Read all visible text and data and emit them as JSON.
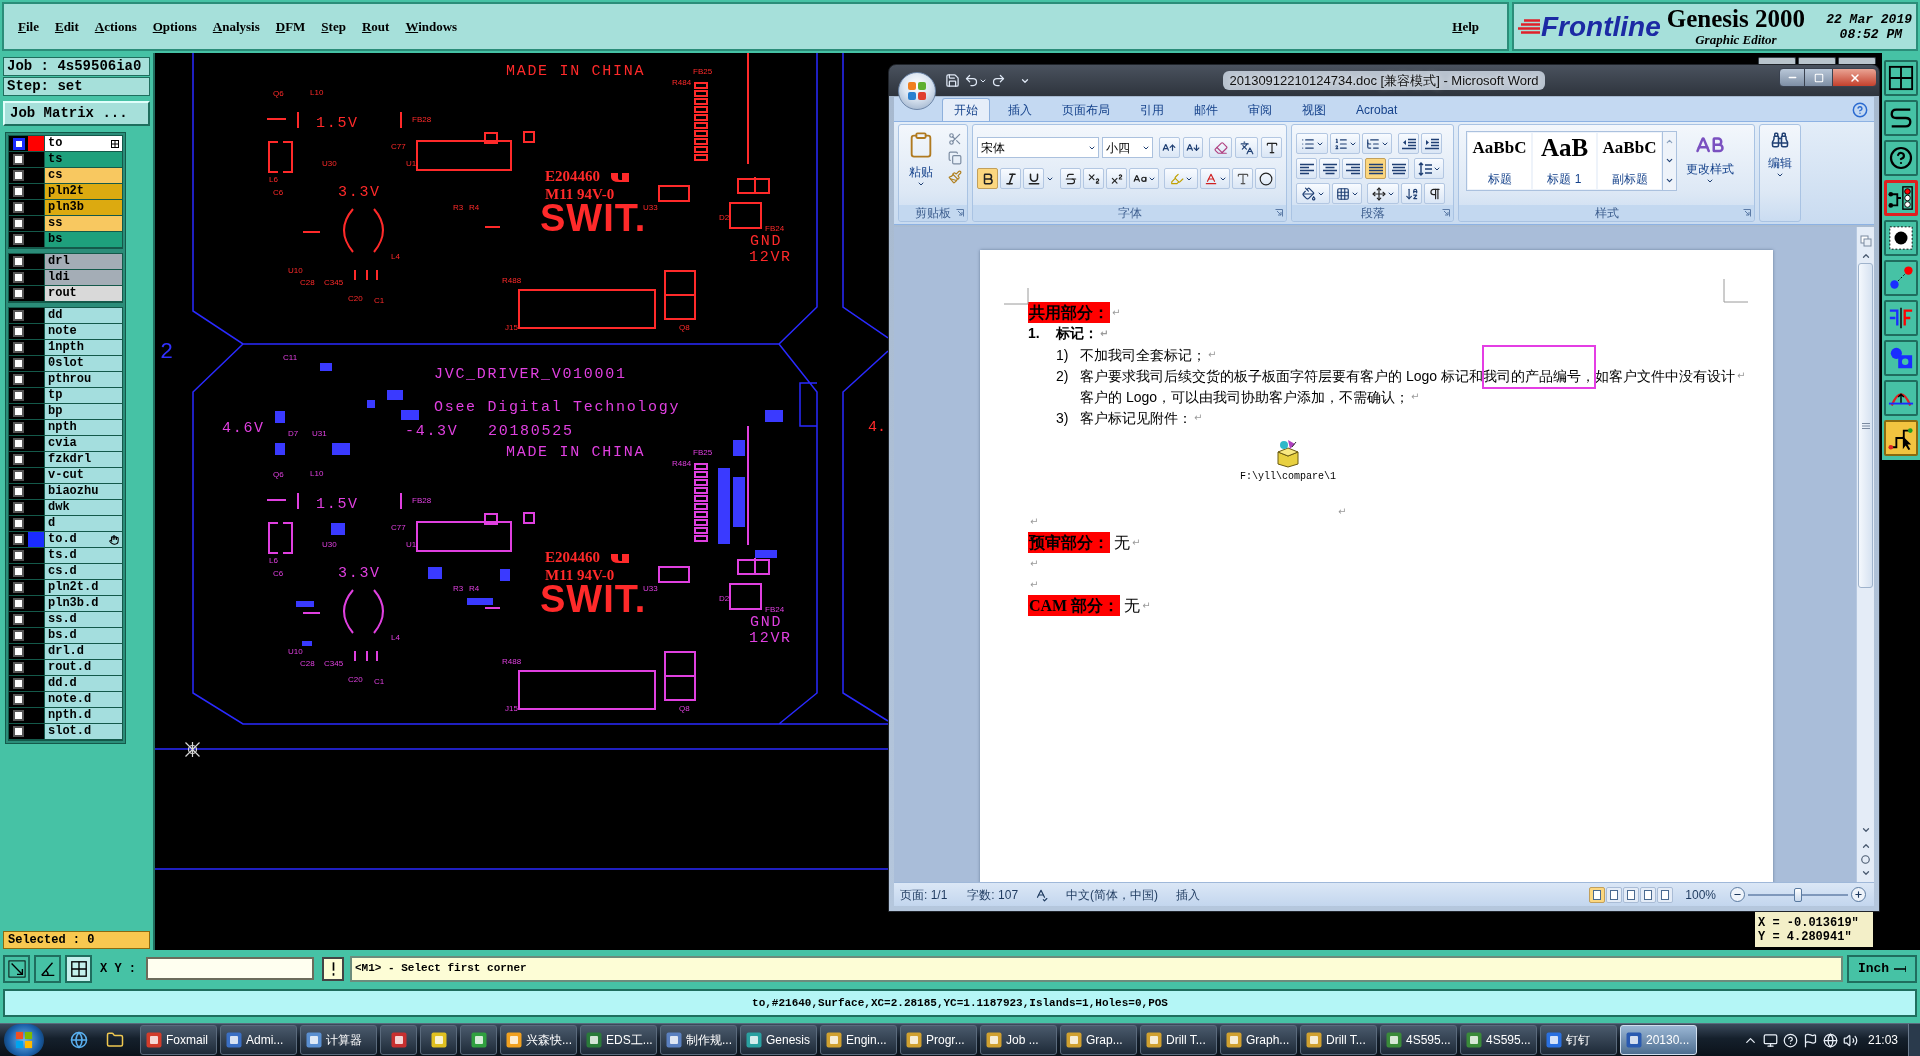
{
  "menu_bar": {
    "items": [
      "File",
      "Edit",
      "Actions",
      "Options",
      "Analysis",
      "DFM",
      "Step",
      "Rout",
      "Windows"
    ],
    "help": "Help"
  },
  "brand": {
    "logo": "Frontline",
    "product": "Genesis 2000",
    "subtitle": "Graphic Editor",
    "date": "22 Mar 2019",
    "time": "08:52 PM"
  },
  "job_panel": {
    "job": "Job : 4s59506ia0",
    "step": "Step: set",
    "matrix_button": "Job Matrix ...",
    "layer_groups": [
      {
        "layers": [
          {
            "name": "to",
            "color": "#ffffff",
            "display": {
              "color": "#ff0000"
            },
            "checked": true,
            "kind": "work"
          },
          {
            "name": "ts",
            "color": "#1ea07c",
            "display": {
              "color": "#000000"
            },
            "checked": false,
            "kind": "plain"
          },
          {
            "name": "cs",
            "color": "#f8c860",
            "display": {
              "color": "#000000"
            },
            "checked": false,
            "kind": "plain"
          },
          {
            "name": "pln2t",
            "color": "#dcaa10",
            "display": {
              "color": "#000000"
            },
            "checked": false,
            "kind": "plain"
          },
          {
            "name": "pln3b",
            "color": "#dcaa10",
            "display": {
              "color": "#000000"
            },
            "checked": false,
            "kind": "plain"
          },
          {
            "name": "ss",
            "color": "#f8c860",
            "display": {
              "color": "#000000"
            },
            "checked": false,
            "kind": "plain"
          },
          {
            "name": "bs",
            "color": "#1ea07c",
            "display": {
              "color": "#000000"
            },
            "checked": false,
            "kind": "plain"
          }
        ]
      },
      {
        "layers": [
          {
            "name": "drl",
            "color": "#a4adb6",
            "display": {
              "color": "#000000"
            },
            "checked": false,
            "kind": "plain"
          },
          {
            "name": "ldi",
            "color": "#a4adb6",
            "display": {
              "color": "#000000"
            },
            "checked": false,
            "kind": "plain"
          },
          {
            "name": "rout",
            "color": "#d9d9d9",
            "display": {
              "color": "#000000"
            },
            "checked": false,
            "kind": "plain"
          }
        ]
      },
      {
        "layers": [
          {
            "name": "dd",
            "color": "#a4dede",
            "display": {
              "color": "#000000"
            },
            "checked": false,
            "kind": "plain"
          },
          {
            "name": "note",
            "color": "#a4dede",
            "display": {
              "color": "#000000"
            },
            "checked": false,
            "kind": "plain"
          },
          {
            "name": "1npth",
            "color": "#a4dede",
            "display": {
              "color": "#000000"
            },
            "checked": false,
            "kind": "plain"
          },
          {
            "name": "0slot",
            "color": "#a4dede",
            "display": {
              "color": "#000000"
            },
            "checked": false,
            "kind": "plain"
          },
          {
            "name": "pthrou",
            "color": "#a4dede",
            "display": {
              "color": "#000000"
            },
            "checked": false,
            "kind": "plain"
          },
          {
            "name": "tp",
            "color": "#a4dede",
            "display": {
              "color": "#000000"
            },
            "checked": false,
            "kind": "plain"
          },
          {
            "name": "bp",
            "color": "#a4dede",
            "display": {
              "color": "#000000"
            },
            "checked": false,
            "kind": "plain"
          },
          {
            "name": "npth",
            "color": "#a4dede",
            "display": {
              "color": "#000000"
            },
            "checked": false,
            "kind": "plain"
          },
          {
            "name": "cvia",
            "color": "#a4dede",
            "display": {
              "color": "#000000"
            },
            "checked": false,
            "kind": "plain"
          },
          {
            "name": "fzkdrl",
            "color": "#a4dede",
            "display": {
              "color": "#000000"
            },
            "checked": false,
            "kind": "plain"
          },
          {
            "name": "v-cut",
            "color": "#a4dede",
            "display": {
              "color": "#000000"
            },
            "checked": false,
            "kind": "plain"
          },
          {
            "name": "biaozhu",
            "color": "#a4dede",
            "display": {
              "color": "#000000"
            },
            "checked": false,
            "kind": "plain"
          },
          {
            "name": "dwk",
            "color": "#a4dede",
            "display": {
              "color": "#000000"
            },
            "checked": false,
            "kind": "plain"
          },
          {
            "name": "d",
            "color": "#a4dede",
            "display": {
              "color": "#000000"
            },
            "checked": false,
            "kind": "plain"
          },
          {
            "name": "to.d",
            "color": "#a4dede",
            "display": {
              "color": "#1a2cff"
            },
            "checked": false,
            "kind": "edit"
          },
          {
            "name": "ts.d",
            "color": "#a4dede",
            "display": {
              "color": "#000000"
            },
            "checked": false,
            "kind": "plain"
          },
          {
            "name": "cs.d",
            "color": "#a4dede",
            "display": {
              "color": "#000000"
            },
            "checked": false,
            "kind": "plain"
          },
          {
            "name": "pln2t.d",
            "color": "#a4dede",
            "display": {
              "color": "#000000"
            },
            "checked": false,
            "kind": "plain"
          },
          {
            "name": "pln3b.d",
            "color": "#a4dede",
            "display": {
              "color": "#000000"
            },
            "checked": false,
            "kind": "plain"
          },
          {
            "name": "ss.d",
            "color": "#a4dede",
            "display": {
              "color": "#000000"
            },
            "checked": false,
            "kind": "plain"
          },
          {
            "name": "bs.d",
            "color": "#a4dede",
            "display": {
              "color": "#000000"
            },
            "checked": false,
            "kind": "plain"
          },
          {
            "name": "drl.d",
            "color": "#a4dede",
            "display": {
              "color": "#000000"
            },
            "checked": false,
            "kind": "plain"
          },
          {
            "name": "rout.d",
            "color": "#a4dede",
            "display": {
              "color": "#000000"
            },
            "checked": false,
            "kind": "plain"
          },
          {
            "name": "dd.d",
            "color": "#a4dede",
            "display": {
              "color": "#000000"
            },
            "checked": false,
            "kind": "plain"
          },
          {
            "name": "note.d",
            "color": "#a4dede",
            "display": {
              "color": "#000000"
            },
            "checked": false,
            "kind": "plain"
          },
          {
            "name": "npth.d",
            "color": "#a4dede",
            "display": {
              "color": "#000000"
            },
            "checked": false,
            "kind": "plain"
          },
          {
            "name": "slot.d",
            "color": "#a4dede",
            "display": {
              "color": "#000000"
            },
            "checked": false,
            "kind": "plain"
          }
        ]
      }
    ],
    "selected": "Selected : 0"
  },
  "canvas": {
    "boards": [
      {
        "color": "#ff2a2a",
        "labels": [
          {
            "text": "MADE IN CHINA",
            "kind": "text"
          },
          {
            "text": "FB25",
            "kind": "ref"
          },
          {
            "text": "R484",
            "kind": "ref"
          },
          {
            "text": "Q6",
            "kind": "ref"
          },
          {
            "text": "L10",
            "kind": "ref"
          },
          {
            "text": "1.5V",
            "kind": "text"
          },
          {
            "text": "FB28",
            "kind": "ref"
          },
          {
            "text": "C77",
            "kind": "ref"
          },
          {
            "text": "U30",
            "kind": "ref"
          },
          {
            "text": "U1",
            "kind": "ref"
          },
          {
            "text": "L6",
            "kind": "ref"
          },
          {
            "text": "E204460",
            "kind": "mark"
          },
          {
            "text": "C6",
            "kind": "ref"
          },
          {
            "text": "3.3V",
            "kind": "text"
          },
          {
            "text": "M11 94V-0",
            "kind": "mark"
          },
          {
            "text": "R3",
            "kind": "ref"
          },
          {
            "text": "R4",
            "kind": "ref"
          },
          {
            "text": "SWIT.",
            "kind": "logo"
          },
          {
            "text": "U33",
            "kind": "ref"
          },
          {
            "text": "D2",
            "kind": "ref"
          },
          {
            "text": "FB24",
            "kind": "ref"
          },
          {
            "text": "GND",
            "kind": "text"
          },
          {
            "text": "L4",
            "kind": "ref"
          },
          {
            "text": "12VR",
            "kind": "text"
          },
          {
            "text": "U10",
            "kind": "ref"
          },
          {
            "text": "C28",
            "kind": "ref"
          },
          {
            "text": "C345",
            "kind": "ref"
          },
          {
            "text": "R488",
            "kind": "ref"
          },
          {
            "text": "C20",
            "kind": "ref"
          },
          {
            "text": "C1",
            "kind": "ref"
          },
          {
            "text": "J15",
            "kind": "ref"
          },
          {
            "text": "Q8",
            "kind": "ref"
          }
        ]
      },
      {
        "color": "#e040e0",
        "pads": {
          "color": "#3a3aff"
        },
        "labels": [
          {
            "text": "C11",
            "kind": "ref"
          },
          {
            "text": "JVC_DRIVER_V010001",
            "kind": "text"
          },
          {
            "text": "Osee Digital Technology",
            "kind": "text"
          },
          {
            "text": "4.6V",
            "kind": "text"
          },
          {
            "text": "D7",
            "kind": "ref"
          },
          {
            "text": "U31",
            "kind": "ref"
          },
          {
            "text": "-4.3V",
            "kind": "text"
          },
          {
            "text": "20180525",
            "kind": "text"
          },
          {
            "text": "MADE IN CHINA",
            "kind": "text"
          },
          {
            "text": "FB25",
            "kind": "ref"
          },
          {
            "text": "R484",
            "kind": "ref"
          },
          {
            "text": "Q6",
            "kind": "ref"
          },
          {
            "text": "L10",
            "kind": "ref"
          },
          {
            "text": "1.5V",
            "kind": "text"
          },
          {
            "text": "FB28",
            "kind": "ref"
          },
          {
            "text": "C77",
            "kind": "ref"
          },
          {
            "text": "U30",
            "kind": "ref"
          },
          {
            "text": "U1",
            "kind": "ref"
          },
          {
            "text": "L6",
            "kind": "ref"
          },
          {
            "text": "E204460",
            "kind": "mark",
            "color": "#ff2a2a"
          },
          {
            "text": "C6",
            "kind": "ref"
          },
          {
            "text": "3.3V",
            "kind": "text"
          },
          {
            "text": "M11 94V-0",
            "kind": "mark",
            "color": "#ff2a2a"
          },
          {
            "text": "R3",
            "kind": "ref"
          },
          {
            "text": "R4",
            "kind": "ref"
          },
          {
            "text": "SWIT.",
            "kind": "logo",
            "color": "#ff2a2a"
          },
          {
            "text": "U33",
            "kind": "ref"
          },
          {
            "text": "D2",
            "kind": "ref"
          },
          {
            "text": "FB24",
            "kind": "ref"
          },
          {
            "text": "GND",
            "kind": "text"
          },
          {
            "text": "L4",
            "kind": "ref"
          },
          {
            "text": "12VR",
            "kind": "text"
          },
          {
            "text": "U10",
            "kind": "ref"
          },
          {
            "text": "C28",
            "kind": "ref"
          },
          {
            "text": "C345",
            "kind": "ref"
          },
          {
            "text": "R488",
            "kind": "ref"
          },
          {
            "text": "C20",
            "kind": "ref"
          },
          {
            "text": "C1",
            "kind": "ref"
          },
          {
            "text": "J15",
            "kind": "ref"
          },
          {
            "text": "Q8",
            "kind": "ref"
          }
        ]
      }
    ],
    "edge_labels": [
      {
        "text": "2",
        "color": "#3030ff"
      },
      {
        "text": "4.",
        "color": "#ff2a2a"
      }
    ],
    "coordinates": {
      "x": "X = -0.013619\"",
      "y": "Y = 4.280941\""
    }
  },
  "right_toolbar": [
    {
      "selected": false,
      "framed": false
    },
    {
      "selected": false,
      "framed": false
    },
    {
      "selected": false,
      "framed": false
    },
    {
      "selected": false,
      "framed": true
    },
    {
      "selected": false,
      "framed": false
    },
    {
      "selected": false,
      "framed": false
    },
    {
      "selected": false,
      "framed": false
    },
    {
      "selected": false,
      "framed": false
    },
    {
      "selected": false,
      "framed": false
    },
    {
      "selected": true,
      "framed": false
    }
  ],
  "control_row": {
    "tools": [
      {
        "selected": false
      },
      {
        "selected": false
      },
      {
        "selected": true
      }
    ],
    "xy_label": "X Y :",
    "message": "<M1> - Select first corner",
    "units": "Inch"
  },
  "status_line": "to,#21640,Surface,XC=2.28185,YC=1.1187923,Islands=1,Holes=0,POS",
  "word": {
    "title": "20130912210124734.doc [兼容模式] - Microsoft Word",
    "tabs": [
      {
        "label": "开始",
        "selected": true
      },
      {
        "label": "插入",
        "selected": false
      },
      {
        "label": "页面布局",
        "selected": false
      },
      {
        "label": "引用",
        "selected": false
      },
      {
        "label": "邮件",
        "selected": false
      },
      {
        "label": "审阅",
        "selected": false
      },
      {
        "label": "视图",
        "selected": false
      },
      {
        "label": "Acrobat",
        "selected": false
      }
    ],
    "ribbon": {
      "clipboard": {
        "paste": "粘贴",
        "label": "剪贴板"
      },
      "font": {
        "name": "宋体",
        "size": "小四",
        "label": "字体",
        "format_buttons": [
          {
            "selected": true
          },
          {
            "selected": false
          },
          {
            "selected": false
          }
        ]
      },
      "paragraph": {
        "label": "段落",
        "align_buttons": [
          {
            "selected": false
          },
          {
            "selected": false
          },
          {
            "selected": false
          },
          {
            "selected": true
          },
          {
            "selected": false
          }
        ]
      },
      "styles": {
        "items": [
          {
            "preview": "AaBbC",
            "name": "标题"
          },
          {
            "preview": "AaB",
            "name": "标题 1"
          },
          {
            "preview": "AaBbC",
            "name": "副标题"
          }
        ],
        "change": "更改样式",
        "label": "样式"
      },
      "editing": {
        "label": "编辑"
      }
    },
    "document": {
      "paragraphs": [
        {
          "kind": "heading",
          "text": "共用部分：",
          "mark": "↵"
        },
        {
          "kind": "numbered",
          "number": "1.",
          "text": "标记：",
          "mark": "↵"
        },
        {
          "kind": "item",
          "number": "1)",
          "text": "不加我司全套标记；",
          "mark": "↵"
        },
        {
          "kind": "item",
          "number": "2)",
          "text": "客户要求我司后续交货的板子板面字符层要有客户的 Logo 标记和我司的产品编号，如客户文件中没有设计",
          "mark": "↵"
        },
        {
          "kind": "continuation",
          "text": "客户的 Logo，可以由我司协助客户添加，不需确认；",
          "mark": "↵"
        },
        {
          "kind": "item",
          "number": "3)",
          "text": "客户标记见附件：",
          "mark": "↵"
        },
        {
          "kind": "object",
          "caption": "F:\\yll\\compare\\1",
          "mark": "↵"
        },
        {
          "kind": "empty",
          "mark": "↵"
        },
        {
          "kind": "heading",
          "text": "预审部分：",
          "value": "无",
          "mark": "↵"
        },
        {
          "kind": "empty",
          "mark": "↵"
        },
        {
          "kind": "empty",
          "mark": "↵"
        },
        {
          "kind": "heading",
          "text": "CAM 部分：",
          "value": "无",
          "mark": "↵"
        }
      ]
    },
    "status_bar": {
      "page": "页面: 1/1",
      "words": "字数: 107",
      "language": "中文(简体，中国)",
      "mode": "插入",
      "view_buttons": [
        {
          "selected": true
        },
        {
          "selected": false
        },
        {
          "selected": false
        },
        {
          "selected": false
        },
        {
          "selected": false
        }
      ],
      "zoom": "100%",
      "zoom_slider": {
        "level": 0.5
      }
    }
  },
  "taskbar": {
    "tasks": [
      {
        "label": "Foxmail",
        "selected": false
      },
      {
        "label": "Admi...",
        "selected": false
      },
      {
        "label": "计算器",
        "selected": false
      },
      {
        "selected": false
      },
      {
        "selected": false
      },
      {
        "selected": false
      },
      {
        "label": "兴森快...",
        "selected": false
      },
      {
        "label": "EDS工...",
        "selected": false
      },
      {
        "label": "制作规...",
        "selected": false
      },
      {
        "label": "Genesis",
        "selected": false
      },
      {
        "label": "Engin...",
        "selected": false
      },
      {
        "label": "Progr...",
        "selected": false
      },
      {
        "label": "Job ...",
        "selected": false
      },
      {
        "label": "Grap...",
        "selected": false
      },
      {
        "label": "Drill T...",
        "selected": false
      },
      {
        "label": "Graph...",
        "selected": false
      },
      {
        "label": "Drill T...",
        "selected": false
      },
      {
        "label": "4S595...",
        "selected": false
      },
      {
        "label": "4S595...",
        "selected": false
      },
      {
        "label": "钉钉",
        "selected": false
      },
      {
        "label": "20130...",
        "selected": true
      }
    ],
    "clock": "21:03"
  }
}
